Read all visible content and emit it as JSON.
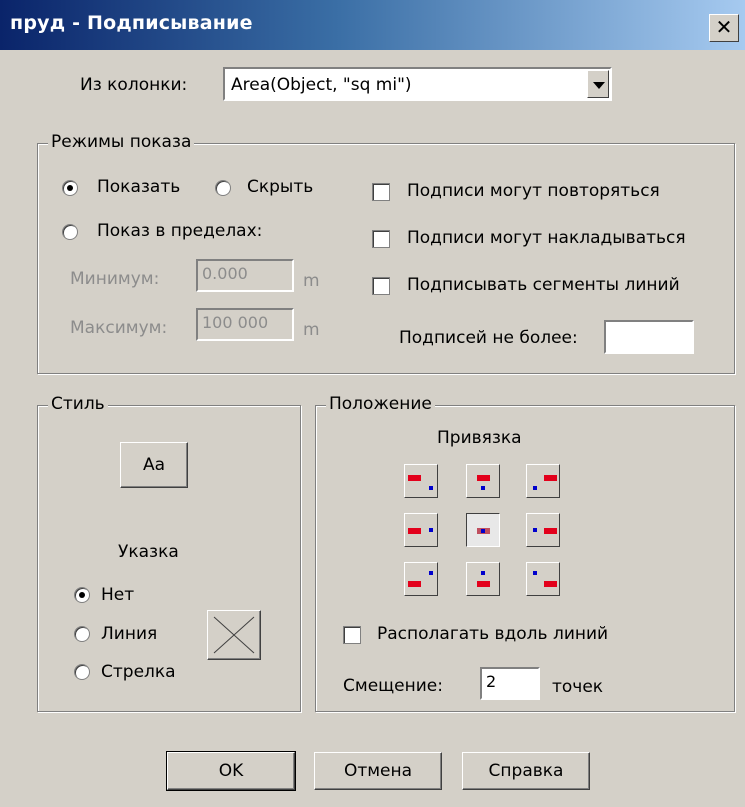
{
  "window": {
    "title": "пруд - Подписывание",
    "close_label": "✕"
  },
  "column": {
    "label": "Из колонки:",
    "value": "Area(Object, \"sq mi\")"
  },
  "display_modes": {
    "legend": "Режимы показа",
    "show_label": "Показать",
    "hide_label": "Скрыть",
    "range_label": "Показ в пределах:",
    "min_label": "Минимум:",
    "min_value": "0.000",
    "min_unit": "m",
    "max_label": "Максимум:",
    "max_value": "100 000",
    "max_unit": "m",
    "dup_label": "Подписи могут повторяться",
    "overlap_label": "Подписи могут накладываться",
    "segments_label": "Подписывать сегменты линий",
    "max_count_label": "Подписей не более:",
    "max_count_value": ""
  },
  "style": {
    "legend": "Стиль",
    "font_button": "Aa",
    "pointer_label": "Указка",
    "none_label": "Нет",
    "line_label": "Линия",
    "arrow_label": "Стрелка"
  },
  "position": {
    "legend": "Положение",
    "anchor_label": "Привязка",
    "along_lines_label": "Располагать вдоль линий",
    "offset_label": "Смещение:",
    "offset_value": "2",
    "offset_unit": "точек"
  },
  "buttons": {
    "ok": "OK",
    "cancel": "Отмена",
    "help": "Справка"
  },
  "colors": {
    "title_start": "#0a246a",
    "title_end": "#a6caf0",
    "face": "#d4d0c8",
    "anchor_red": "#e3001b",
    "anchor_blue": "#0000cc"
  }
}
